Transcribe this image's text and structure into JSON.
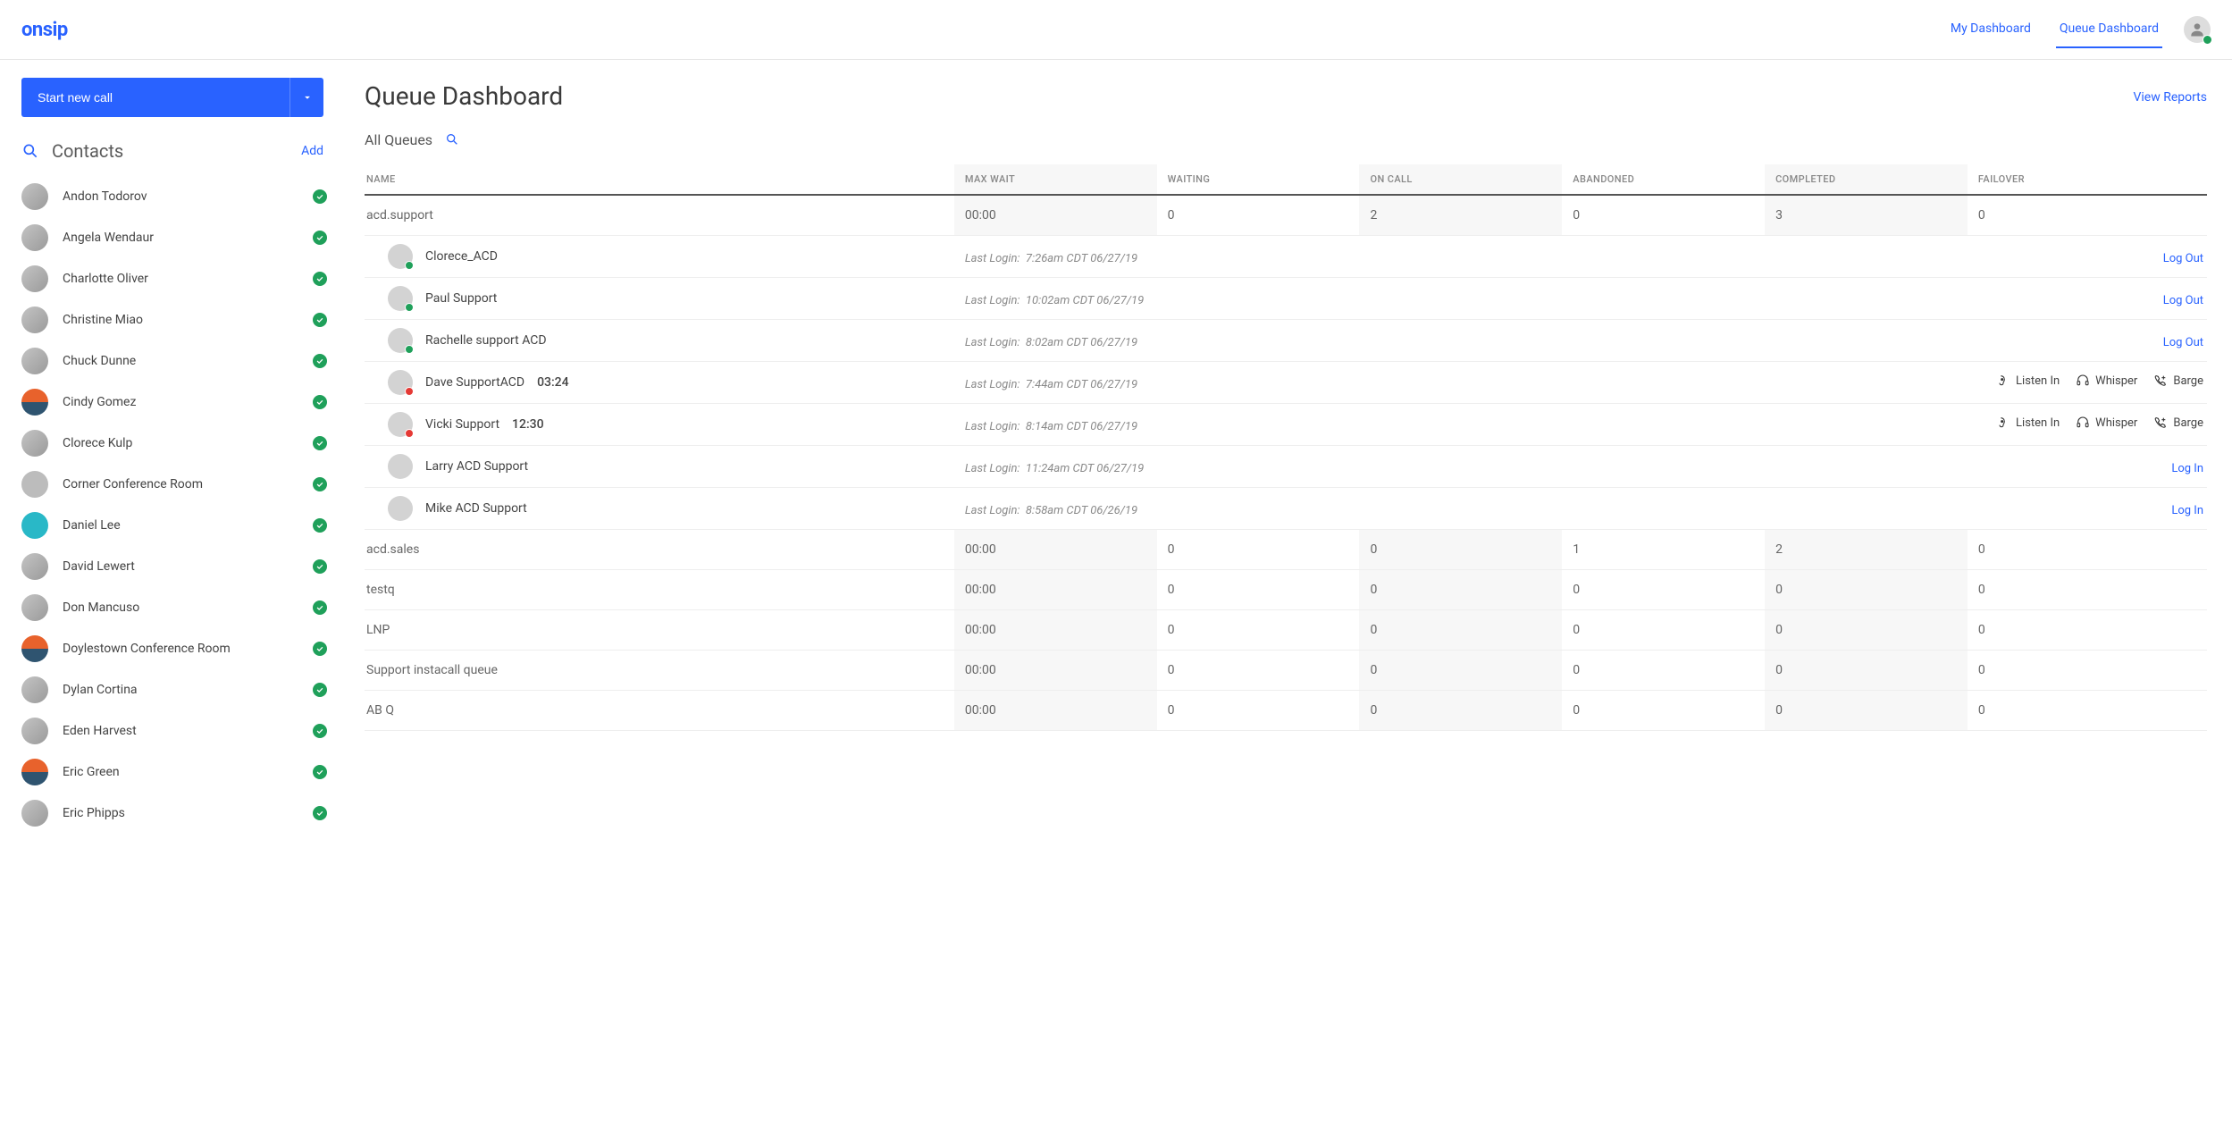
{
  "header": {
    "logo": "onsip",
    "nav_my_dashboard": "My Dashboard",
    "nav_queue_dashboard": "Queue Dashboard"
  },
  "sidebar": {
    "start_call_label": "Start new call",
    "contacts_title": "Contacts",
    "add_label": "Add",
    "contacts": [
      {
        "name": "Andon Todorov",
        "av": "plain"
      },
      {
        "name": "Angela Wendaur",
        "av": "plain"
      },
      {
        "name": "Charlotte Oliver",
        "av": "plain"
      },
      {
        "name": "Christine Miao",
        "av": "plain"
      },
      {
        "name": "Chuck Dunne",
        "av": "plain"
      },
      {
        "name": "Cindy Gomez",
        "av": "orange"
      },
      {
        "name": "Clorece Kulp",
        "av": "plain"
      },
      {
        "name": "Corner Conference Room",
        "av": "grey"
      },
      {
        "name": "Daniel Lee",
        "av": "teal"
      },
      {
        "name": "David Lewert",
        "av": "plain"
      },
      {
        "name": "Don Mancuso",
        "av": "plain"
      },
      {
        "name": "Doylestown Conference Room",
        "av": "orange"
      },
      {
        "name": "Dylan Cortina",
        "av": "plain"
      },
      {
        "name": "Eden Harvest",
        "av": "plain"
      },
      {
        "name": "Eric Green",
        "av": "orange"
      },
      {
        "name": "Eric Phipps",
        "av": "plain"
      }
    ]
  },
  "main": {
    "page_title": "Queue Dashboard",
    "view_reports": "View Reports",
    "all_queues": "All Queues",
    "columns": {
      "name": "NAME",
      "max_wait": "MAX WAIT",
      "waiting": "WAITING",
      "on_call": "ON CALL",
      "abandoned": "ABANDONED",
      "completed": "COMPLETED",
      "failover": "FAILOVER"
    },
    "last_login_label": "Last Login:",
    "actions": {
      "listen_in": "Listen In",
      "whisper": "Whisper",
      "barge": "Barge",
      "log_out": "Log Out",
      "log_in": "Log In"
    },
    "queues": [
      {
        "name": "acd.support",
        "max_wait": "00:00",
        "waiting": "0",
        "on_call": "2",
        "abandoned": "0",
        "completed": "3",
        "failover": "0"
      },
      {
        "name": "acd.sales",
        "max_wait": "00:00",
        "waiting": "0",
        "on_call": "0",
        "abandoned": "1",
        "completed": "2",
        "failover": "0"
      },
      {
        "name": "testq",
        "max_wait": "00:00",
        "waiting": "0",
        "on_call": "0",
        "abandoned": "0",
        "completed": "0",
        "failover": "0"
      },
      {
        "name": "LNP",
        "max_wait": "00:00",
        "waiting": "0",
        "on_call": "0",
        "abandoned": "0",
        "completed": "0",
        "failover": "0"
      },
      {
        "name": "Support instacall queue",
        "max_wait": "00:00",
        "waiting": "0",
        "on_call": "0",
        "abandoned": "0",
        "completed": "0",
        "failover": "0"
      },
      {
        "name": "AB Q",
        "max_wait": "00:00",
        "waiting": "0",
        "on_call": "0",
        "abandoned": "0",
        "completed": "0",
        "failover": "0"
      }
    ],
    "agents": [
      {
        "name": "Clorece_ACD",
        "timer": "",
        "login": "7:26am CDT 06/27/19",
        "status": "green",
        "mode": "logout"
      },
      {
        "name": "Paul Support",
        "timer": "",
        "login": "10:02am CDT 06/27/19",
        "status": "green",
        "mode": "logout"
      },
      {
        "name": "Rachelle support ACD",
        "timer": "",
        "login": "8:02am CDT 06/27/19",
        "status": "green",
        "mode": "logout"
      },
      {
        "name": "Dave SupportACD",
        "timer": "03:24",
        "login": "7:44am CDT 06/27/19",
        "status": "red",
        "mode": "monitor"
      },
      {
        "name": "Vicki Support",
        "timer": "12:30",
        "login": "8:14am CDT 06/27/19",
        "status": "red",
        "mode": "monitor"
      },
      {
        "name": "Larry ACD Support",
        "timer": "",
        "login": "11:24am CDT 06/27/19",
        "status": "none",
        "mode": "login"
      },
      {
        "name": "Mike ACD Support",
        "timer": "",
        "login": "8:58am CDT 06/26/19",
        "status": "none",
        "mode": "login"
      }
    ]
  }
}
